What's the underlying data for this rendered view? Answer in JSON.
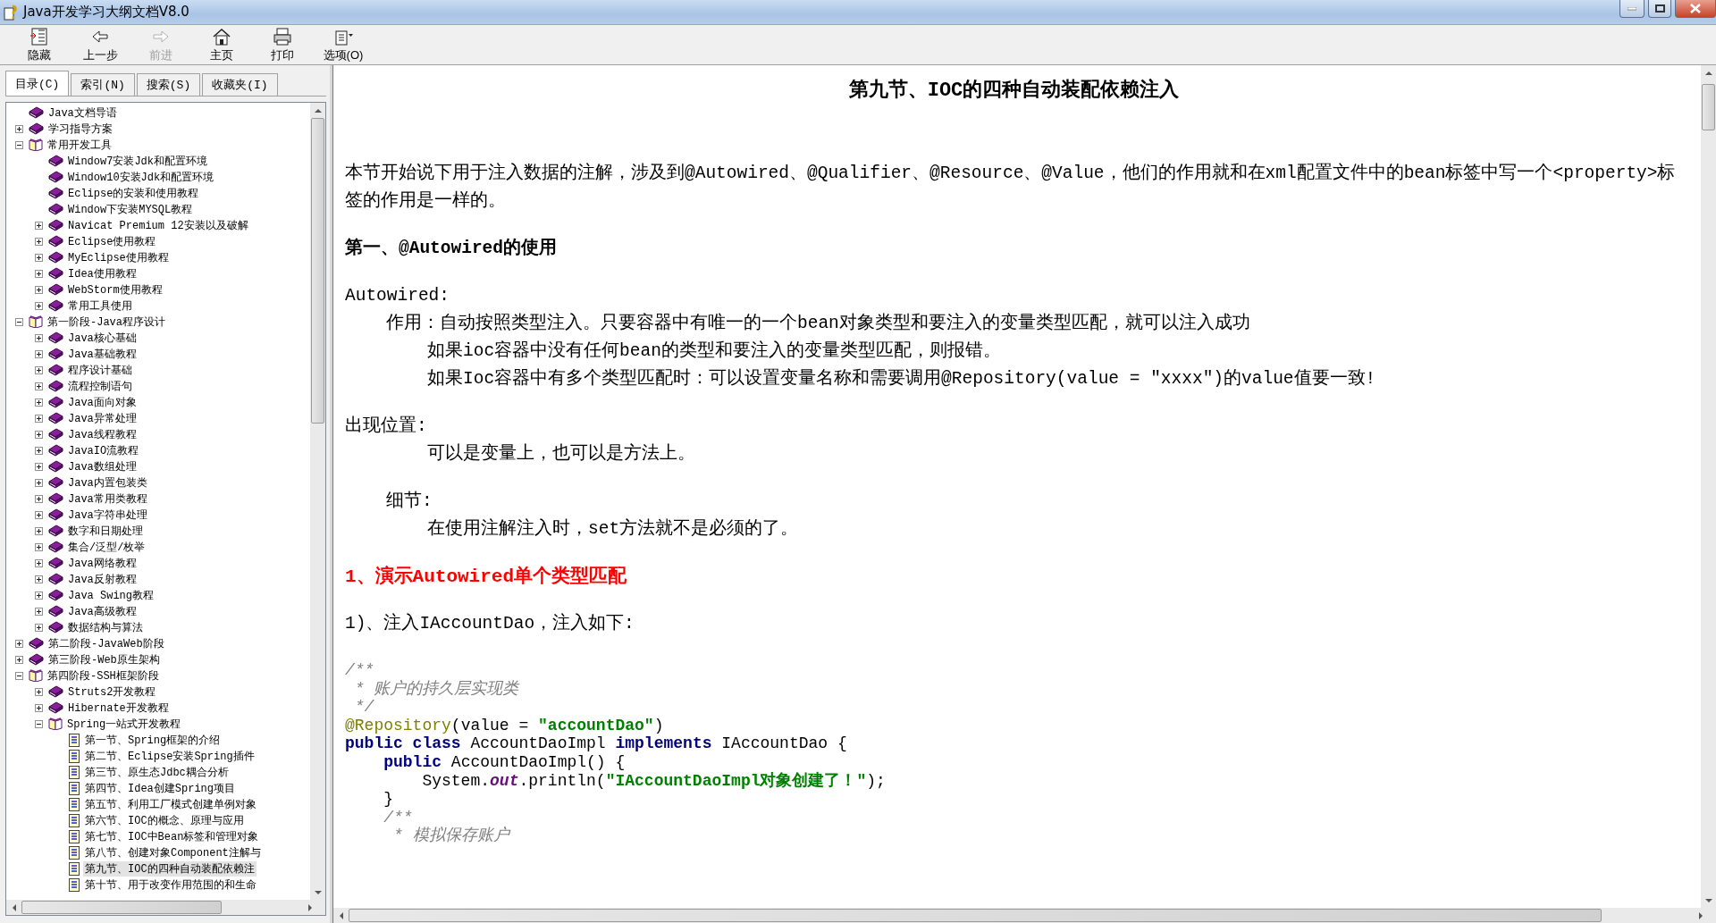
{
  "window": {
    "title": "Java开发学习大纲文档V8.0"
  },
  "toolbar": [
    {
      "label": "隐藏",
      "kind": "hide",
      "disabled": false
    },
    {
      "label": "上一步",
      "kind": "back",
      "disabled": false
    },
    {
      "label": "前进",
      "kind": "forward",
      "disabled": true
    },
    {
      "label": "主页",
      "kind": "home",
      "disabled": false
    },
    {
      "label": "打印",
      "kind": "print",
      "disabled": false
    },
    {
      "label": "选项(O)",
      "kind": "options",
      "disabled": false
    }
  ],
  "nav_tabs": [
    {
      "label": "目录(C)",
      "selected": true
    },
    {
      "label": "索引(N)",
      "selected": false
    },
    {
      "label": "搜索(S)",
      "selected": false
    },
    {
      "label": "收藏夹(I)",
      "selected": false
    }
  ],
  "tree": [
    {
      "label": "Java文档导语",
      "kind": "book",
      "selected": false
    },
    {
      "label": "学习指导方案",
      "kind": "book",
      "expanded": false,
      "selected": false
    },
    {
      "label": "常用开发工具",
      "kind": "book",
      "expanded": true,
      "selected": false,
      "children": [
        {
          "label": "Window7安装Jdk和配置环境",
          "kind": "book",
          "selected": false
        },
        {
          "label": "Window10安装Jdk和配置环境",
          "kind": "book",
          "selected": false
        },
        {
          "label": "Eclipse的安装和使用教程",
          "kind": "book",
          "selected": false
        },
        {
          "label": "Window下安装MYSQL教程",
          "kind": "book",
          "selected": false
        },
        {
          "label": "Navicat Premium 12安装以及破解",
          "kind": "book",
          "expanded": false,
          "selected": false
        },
        {
          "label": "Eclipse使用教程",
          "kind": "book",
          "expanded": false,
          "selected": false
        },
        {
          "label": "MyEclipse使用教程",
          "kind": "book",
          "expanded": false,
          "selected": false
        },
        {
          "label": "Idea使用教程",
          "kind": "book",
          "expanded": false,
          "selected": false
        },
        {
          "label": "WebStorm使用教程",
          "kind": "book",
          "expanded": false,
          "selected": false
        },
        {
          "label": "常用工具使用",
          "kind": "book",
          "expanded": false,
          "selected": false
        }
      ]
    },
    {
      "label": "第一阶段-Java程序设计",
      "kind": "book",
      "expanded": true,
      "selected": false,
      "children": [
        {
          "label": "Java核心基础",
          "kind": "book",
          "expanded": false,
          "selected": false
        },
        {
          "label": "Java基础教程",
          "kind": "book",
          "expanded": false,
          "selected": false
        },
        {
          "label": "程序设计基础",
          "kind": "book",
          "expanded": false,
          "selected": false
        },
        {
          "label": "流程控制语句",
          "kind": "book",
          "expanded": false,
          "selected": false
        },
        {
          "label": "Java面向对象",
          "kind": "book",
          "expanded": false,
          "selected": false
        },
        {
          "label": "Java异常处理",
          "kind": "book",
          "expanded": false,
          "selected": false
        },
        {
          "label": "Java线程教程",
          "kind": "book",
          "expanded": false,
          "selected": false
        },
        {
          "label": "JavaIO流教程",
          "kind": "book",
          "expanded": false,
          "selected": false
        },
        {
          "label": "Java数组处理",
          "kind": "book",
          "expanded": false,
          "selected": false
        },
        {
          "label": "Java内置包装类",
          "kind": "book",
          "expanded": false,
          "selected": false
        },
        {
          "label": "Java常用类教程",
          "kind": "book",
          "expanded": false,
          "selected": false
        },
        {
          "label": "Java字符串处理",
          "kind": "book",
          "expanded": false,
          "selected": false
        },
        {
          "label": "数字和日期处理",
          "kind": "book",
          "expanded": false,
          "selected": false
        },
        {
          "label": "集合/泛型/枚举",
          "kind": "book",
          "expanded": false,
          "selected": false
        },
        {
          "label": "Java网络教程",
          "kind": "book",
          "expanded": false,
          "selected": false
        },
        {
          "label": "Java反射教程",
          "kind": "book",
          "expanded": false,
          "selected": false
        },
        {
          "label": "Java Swing教程",
          "kind": "book",
          "expanded": false,
          "selected": false
        },
        {
          "label": "Java高级教程",
          "kind": "book",
          "expanded": false,
          "selected": false
        },
        {
          "label": "数据结构与算法",
          "kind": "book",
          "expanded": false,
          "selected": false
        }
      ]
    },
    {
      "label": "第二阶段-JavaWeb阶段",
      "kind": "book",
      "expanded": false,
      "selected": false
    },
    {
      "label": "第三阶段-Web原生架构",
      "kind": "book",
      "expanded": false,
      "selected": false
    },
    {
      "label": "第四阶段-SSH框架阶段",
      "kind": "book",
      "expanded": true,
      "selected": false,
      "children": [
        {
          "label": "Struts2开发教程",
          "kind": "book",
          "expanded": false,
          "selected": false
        },
        {
          "label": "Hibernate开发教程",
          "kind": "book",
          "expanded": false,
          "selected": false
        },
        {
          "label": "Spring一站式开发教程",
          "kind": "book",
          "expanded": true,
          "selected": false,
          "children": [
            {
              "label": "第一节、Spring框架的介绍",
              "kind": "page",
              "selected": false
            },
            {
              "label": "第二节、Eclipse安装Spring插件",
              "kind": "page",
              "selected": false
            },
            {
              "label": "第三节、原生态Jdbc耦合分析",
              "kind": "page",
              "selected": false
            },
            {
              "label": "第四节、Idea创建Spring项目",
              "kind": "page",
              "selected": false
            },
            {
              "label": "第五节、利用工厂模式创建单例对象",
              "kind": "page",
              "selected": false
            },
            {
              "label": "第六节、IOC的概念、原理与应用",
              "kind": "page",
              "selected": false
            },
            {
              "label": "第七节、IOC中Bean标签和管理对象",
              "kind": "page",
              "selected": false
            },
            {
              "label": "第八节、创建对象Component注解与",
              "kind": "page",
              "selected": false
            },
            {
              "label": "第九节、IOC的四种自动装配依赖注",
              "kind": "page",
              "selected": true
            },
            {
              "label": "第十节、用于改变作用范围的和生命",
              "kind": "page",
              "selected": false
            }
          ]
        }
      ]
    }
  ],
  "article": {
    "title": "第九节、IOC的四种自动装配依赖注入",
    "blocks": [
      {
        "kind": "para",
        "text": "本节开始说下用于注入数据的注解，涉及到@Autowired、@Qualifier、@Resource、@Value，他们的作用就和在xml配置文件中的bean标签中写一个<property>标签的作用是一样的。"
      },
      {
        "kind": "heading",
        "text": "第一、@Autowired的使用"
      },
      {
        "kind": "label",
        "text": "Autowired:"
      },
      {
        "kind": "indent1",
        "text": "作用：自动按照类型注入。只要容器中有唯一的一个bean对象类型和要注入的变量类型匹配，就可以注入成功"
      },
      {
        "kind": "indent2",
        "text": "如果ioc容器中没有任何bean的类型和要注入的变量类型匹配，则报错。"
      },
      {
        "kind": "indent2",
        "text": "如果Ioc容器中有多个类型匹配时：可以设置变量名称和需要调用@Repository(value = \"xxxx\")的value值要一致!"
      },
      {
        "kind": "label",
        "text": "出现位置:"
      },
      {
        "kind": "indent2",
        "text": "可以是变量上，也可以是方法上。"
      },
      {
        "kind": "label1",
        "text": "细节:"
      },
      {
        "kind": "indent2",
        "text": "在使用注解注入时，set方法就不是必须的了。"
      },
      {
        "kind": "red",
        "text": "1、演示Autowired单个类型匹配"
      },
      {
        "kind": "label",
        "text": "1)、注入IAccountDao，注入如下:"
      }
    ],
    "code": [
      [
        {
          "kind": "comment",
          "text": "/**"
        }
      ],
      [
        {
          "kind": "comment",
          "text": " * 账户的持久层实现类"
        }
      ],
      [
        {
          "kind": "comment",
          "text": " */"
        }
      ],
      [
        {
          "kind": "annotation",
          "text": "@Repository"
        },
        {
          "kind": "plain",
          "text": "(value = "
        },
        {
          "kind": "string",
          "text": "\"accountDao\""
        },
        {
          "kind": "plain",
          "text": ")"
        }
      ],
      [
        {
          "kind": "keyword",
          "text": "public class "
        },
        {
          "kind": "plain",
          "text": "AccountDaoImpl "
        },
        {
          "kind": "keyword",
          "text": "implements "
        },
        {
          "kind": "plain",
          "text": "IAccountDao {"
        }
      ],
      [
        {
          "kind": "keyword",
          "text": "    public "
        },
        {
          "kind": "plain",
          "text": "AccountDaoImpl() {"
        }
      ],
      [
        {
          "kind": "plain",
          "text": "        System."
        },
        {
          "kind": "field",
          "text": "out"
        },
        {
          "kind": "plain",
          "text": ".println("
        },
        {
          "kind": "string",
          "text": "\"IAccountDaoImpl对象创建了！\""
        },
        {
          "kind": "plain",
          "text": ");"
        }
      ],
      [
        {
          "kind": "plain",
          "text": "    }"
        }
      ],
      [
        {
          "kind": "comment",
          "text": "    /**"
        }
      ],
      [
        {
          "kind": "comment",
          "text": "     * 模拟保存账户"
        }
      ]
    ]
  }
}
